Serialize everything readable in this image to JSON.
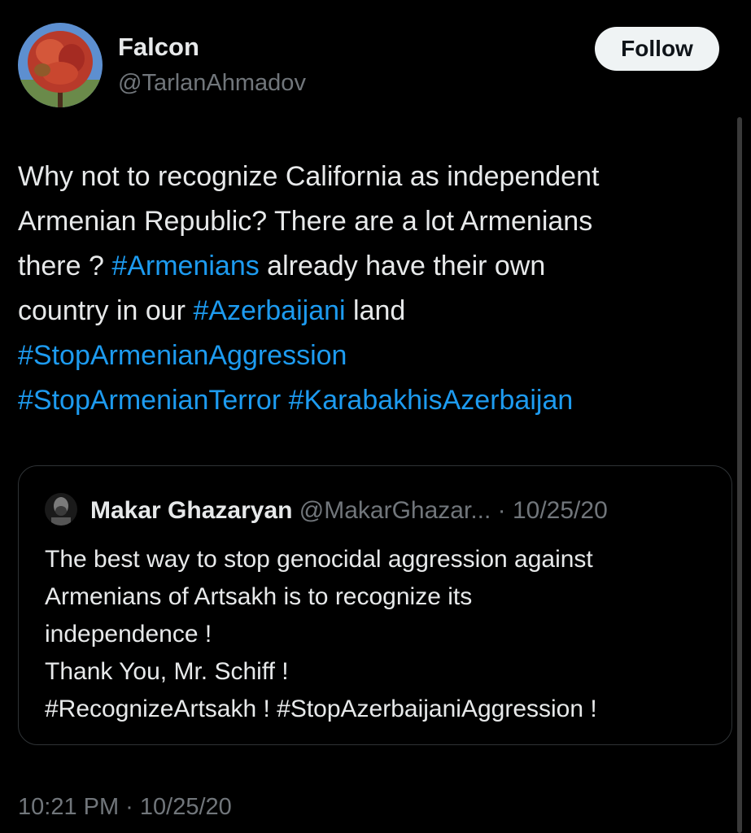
{
  "author": {
    "name": "Falcon",
    "handle": "@TarlanAhmadov",
    "follow_label": "Follow"
  },
  "tweet": {
    "segments": {
      "s1": "Why not to recognize California as independent",
      "s2": "Armenian Republic? There are a lot Armenians",
      "s3": "there ? ",
      "s4": "#Armenians",
      "s5": " already have their own",
      "s6": "country in our ",
      "s7": "#Azerbaijani",
      "s8": " land",
      "s9": "#StopArmenianAggression",
      "s10": "#StopArmenianTerror",
      "s11": " ",
      "s12": "#KarabakhisAzerbaijan"
    },
    "timestamp": "10:21 PM · 10/25/20"
  },
  "quote": {
    "name": "Makar Ghazaryan",
    "meta": " @MakarGhazar... · 10/25/20",
    "lines": [
      "The best way to stop genocidal aggression against",
      "Armenians of Artsakh is to recognize its",
      "independence !",
      "Thank You, Mr. Schiff !",
      "#RecognizeArtsakh ! #StopAzerbaijaniAggression !"
    ]
  },
  "colors": {
    "background": "#000000",
    "text": "#e7e9ea",
    "secondary": "#71767b",
    "link": "#1d9bf0",
    "follow_bg": "#eff3f4"
  }
}
